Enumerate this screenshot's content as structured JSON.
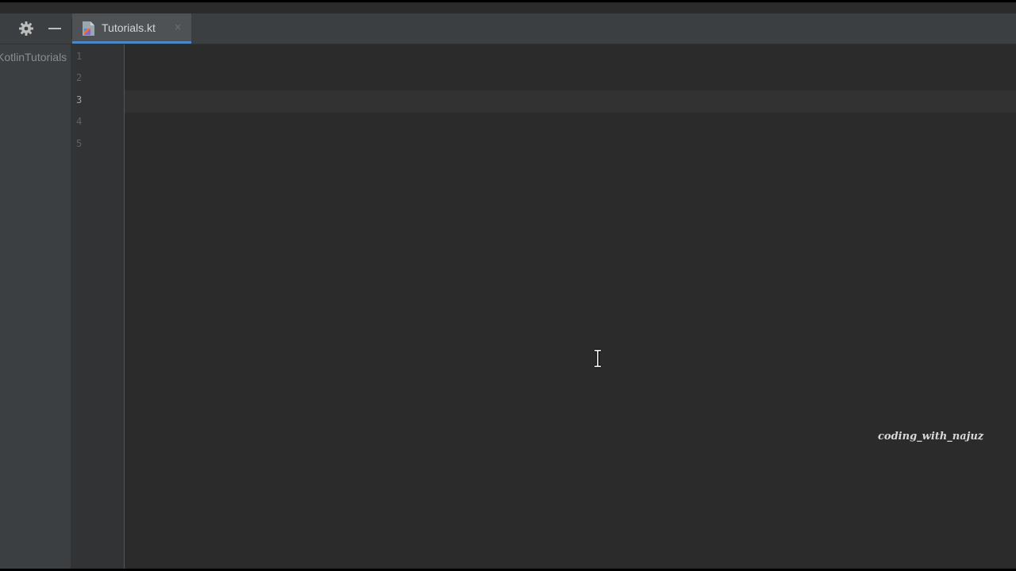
{
  "window": {
    "tab_bar": {
      "tools": [
        {
          "icon": "gear-icon"
        },
        {
          "icon": "minimize-icon"
        }
      ],
      "active_tab": {
        "label": "Tutorials.kt",
        "icon": "kotlin-file-icon",
        "close_glyph": "×"
      }
    },
    "project_panel": {
      "item_label": "KotlinTutorials"
    },
    "editor": {
      "line_numbers": [
        "1",
        "2",
        "3",
        "4",
        "5"
      ],
      "current_line": 3,
      "watermark": "coding_with_najuz"
    }
  },
  "colors": {
    "editor_bg": "#2b2b2b",
    "panel_bg": "#3c3f41",
    "gutter_bg": "#313335",
    "accent": "#4a88c7"
  }
}
